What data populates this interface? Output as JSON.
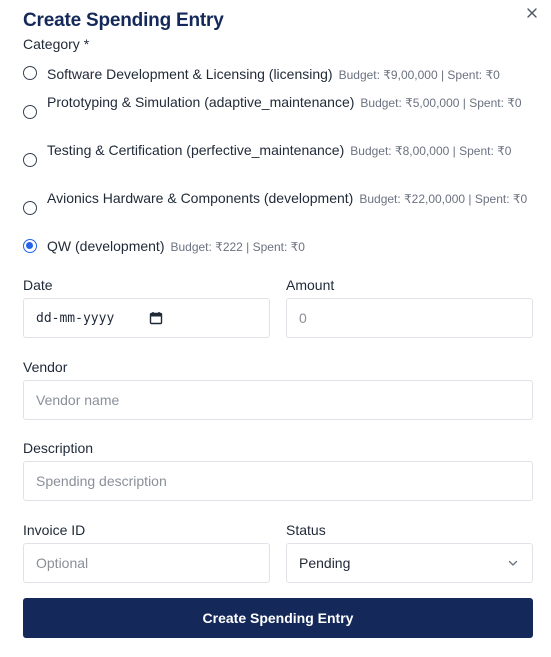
{
  "dialog": {
    "title": "Create Spending Entry",
    "close_icon": "close-icon"
  },
  "category": {
    "label": "Category *",
    "options": [
      {
        "name": "Software Development & Licensing (licensing)",
        "meta": "Budget: ₹9,00,000 | Spent: ₹0",
        "selected": false
      },
      {
        "name": "Prototyping & Simulation (adaptive_maintenance)",
        "meta": "Budget: ₹5,00,000 | Spent: ₹0",
        "selected": false
      },
      {
        "name": "Testing & Certification (perfective_maintenance)",
        "meta": "Budget: ₹8,00,000 | Spent: ₹0",
        "selected": false
      },
      {
        "name": "Avionics Hardware & Components (development)",
        "meta": "Budget: ₹22,00,000 | Spent: ₹0",
        "selected": false
      },
      {
        "name": "QW (development)",
        "meta": "Budget: ₹222 | Spent: ₹0",
        "selected": true
      }
    ]
  },
  "date": {
    "label": "Date",
    "value": "dd-mm-yyyy",
    "icon": "calendar-icon"
  },
  "amount": {
    "label": "Amount",
    "placeholder": "0"
  },
  "vendor": {
    "label": "Vendor",
    "placeholder": "Vendor name"
  },
  "description": {
    "label": "Description",
    "placeholder": "Spending description"
  },
  "invoice": {
    "label": "Invoice ID",
    "placeholder": "Optional"
  },
  "status": {
    "label": "Status",
    "value": "Pending",
    "icon": "chevron-down-icon"
  },
  "submit": {
    "label": "Create Spending Entry"
  },
  "colors": {
    "primary": "#14295a",
    "radio_selected": "#2563eb",
    "border": "#dfe3e8"
  }
}
